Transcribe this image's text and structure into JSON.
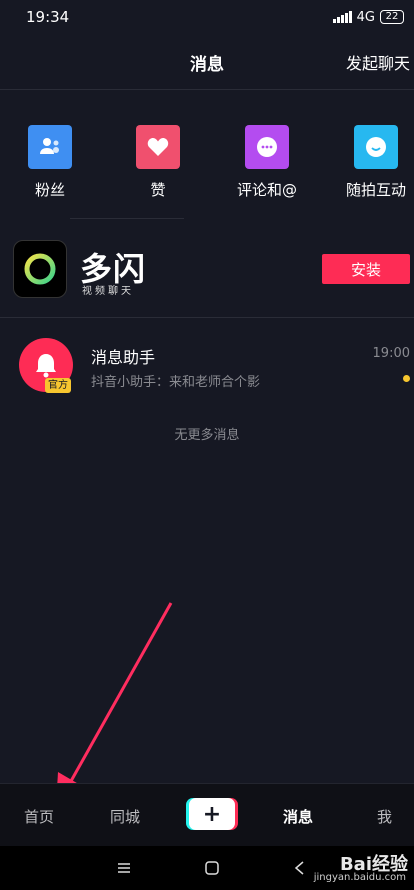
{
  "status_bar": {
    "time": "19:34",
    "network": "4G",
    "battery": "22"
  },
  "header": {
    "title": "消息",
    "action": "发起聊天"
  },
  "quick_actions": [
    {
      "label": "粉丝",
      "icon": "fans-icon",
      "color": "#3f8ff2"
    },
    {
      "label": "赞",
      "icon": "heart-icon",
      "color": "#f0506e"
    },
    {
      "label": "评论和@",
      "icon": "comment-icon",
      "color": "#b44cf0"
    },
    {
      "label": "随拍互动",
      "icon": "interact-icon",
      "color": "#27b8f0"
    }
  ],
  "ad": {
    "name": "多闪",
    "subtitle": "视频聊天",
    "button": "安装"
  },
  "messages": [
    {
      "name": "消息助手",
      "preview": "抖音小助手：来和老师合个影",
      "time": "19:00",
      "badge": "官方"
    }
  ],
  "no_more": "无更多消息",
  "tabbar": {
    "home": "首页",
    "city": "同城",
    "plus": "+",
    "messages": "消息",
    "me": "我"
  },
  "watermark": {
    "brand": "Bai经验",
    "url": "jingyan.baidu.com"
  },
  "colors": {
    "background": "#161823",
    "accent": "#fe2c55",
    "badge": "#f7c62f"
  }
}
